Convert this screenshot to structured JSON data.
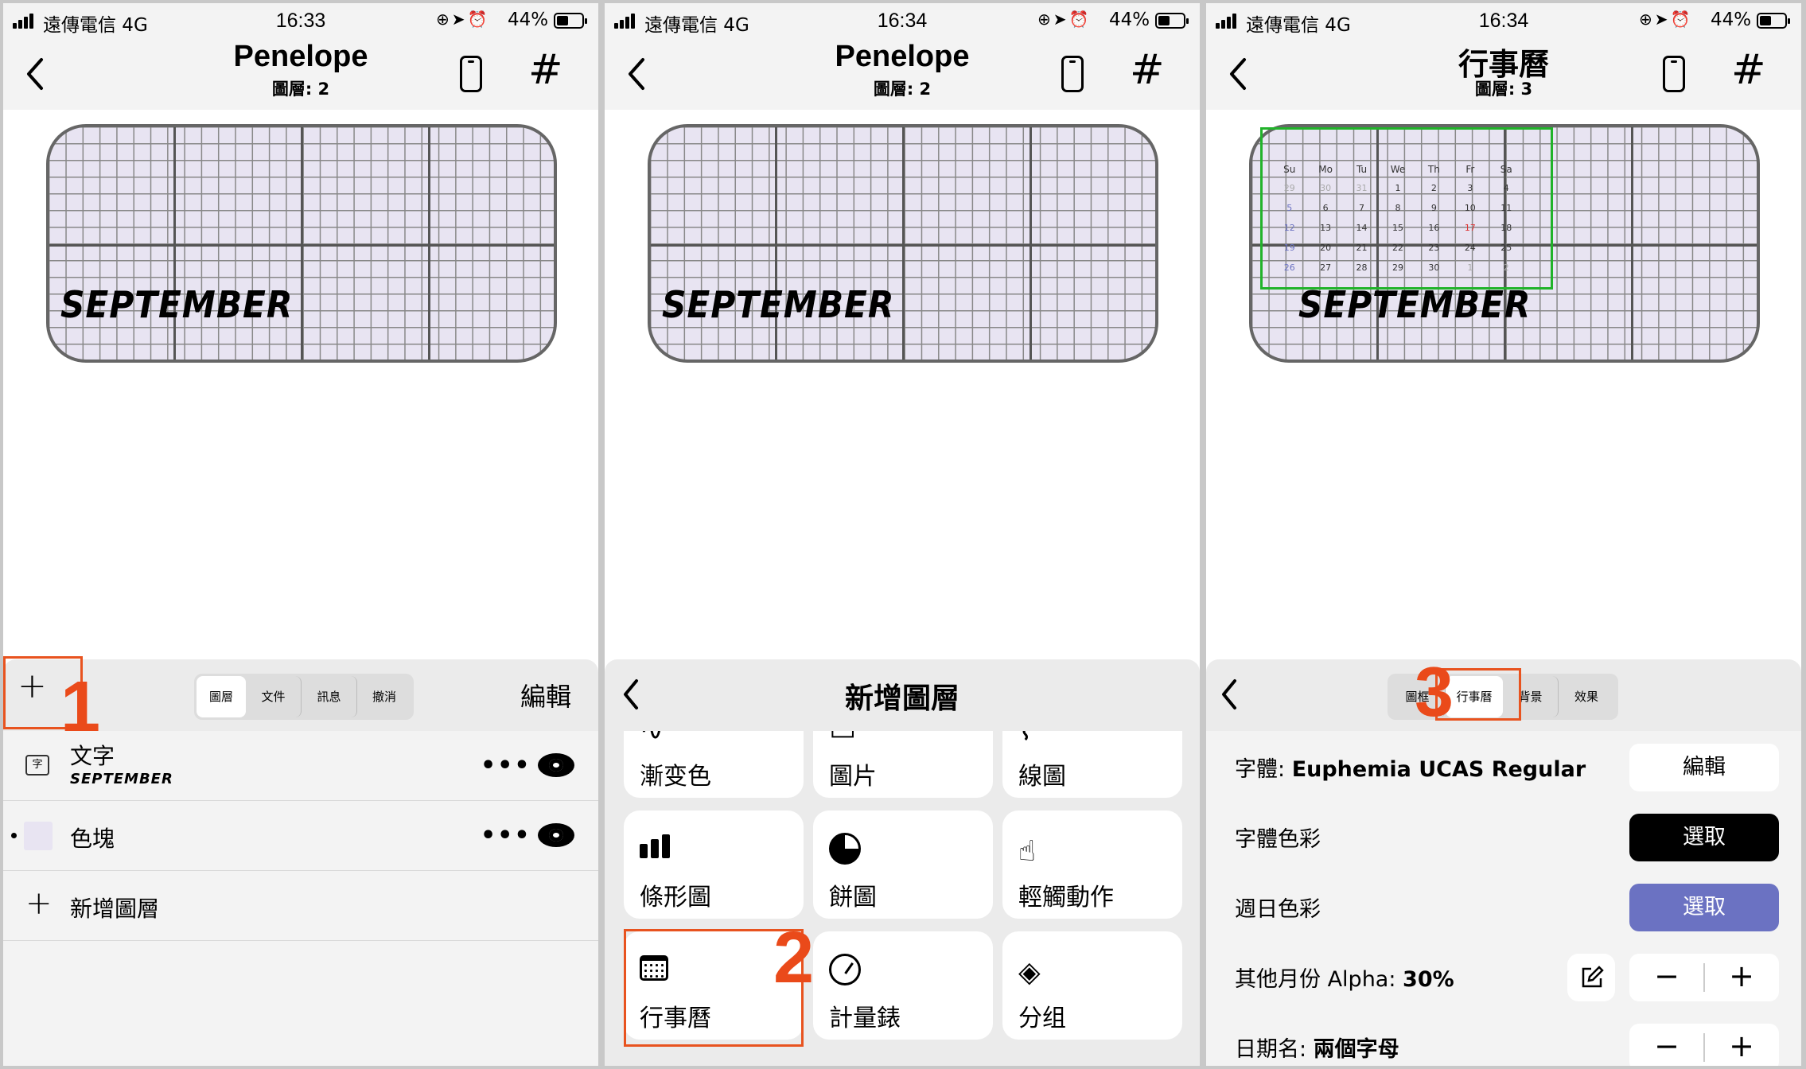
{
  "colors": {
    "accent_red": "#e8531f",
    "green_highlight": "#21b32a",
    "purple_button": "#6b72c2",
    "card_fill": "#e8e4f2"
  },
  "panels": [
    {
      "status": {
        "carrier": "遠傳電信  4G",
        "time": "16:33",
        "battery": "44%"
      },
      "nav": {
        "title": "Penelope",
        "subtitle": "圖層: 2"
      },
      "card_text": "SEPTEMBER",
      "toolbar": {
        "add": "+",
        "tabs": [
          "圖層",
          "文件",
          "訊息",
          "撤消"
        ],
        "edit": "編輯",
        "step": "1"
      },
      "layers": [
        {
          "name": "文字",
          "detail": "SEPTEMBER",
          "icon": "字"
        },
        {
          "name": "色塊",
          "detail": ""
        }
      ],
      "add_layer": "新增圖層"
    },
    {
      "status": {
        "carrier": "遠傳電信  4G",
        "time": "16:34",
        "battery": "44%"
      },
      "nav": {
        "title": "Penelope",
        "subtitle": "圖層: 2"
      },
      "card_text": "SEPTEMBER",
      "header": "新增圖層",
      "step": "2",
      "tiles": [
        "漸变色",
        "圖片",
        "線圖",
        "條形圖",
        "餅圖",
        "輕觸動作",
        "行事曆",
        "計量錶",
        "分组"
      ]
    },
    {
      "status": {
        "carrier": "遠傳電信  4G",
        "time": "16:34",
        "battery": "44%"
      },
      "nav": {
        "title": "行事曆",
        "subtitle": "圖層: 3"
      },
      "card_text": "SEPTEMBER",
      "tabs": [
        "圖框",
        "行事曆",
        "背景",
        "效果"
      ],
      "step": "3",
      "calendar": {
        "days": [
          "Su",
          "Mo",
          "Tu",
          "We",
          "Th",
          "Fr",
          "Sa"
        ],
        "weeks": [
          [
            "29",
            "30",
            "31",
            "1",
            "2",
            "3",
            "4"
          ],
          [
            "5",
            "6",
            "7",
            "8",
            "9",
            "10",
            "11"
          ],
          [
            "12",
            "13",
            "14",
            "15",
            "16",
            "17",
            "18"
          ],
          [
            "19",
            "20",
            "21",
            "22",
            "23",
            "24",
            "25"
          ],
          [
            "26",
            "27",
            "28",
            "29",
            "30",
            "1",
            "2"
          ]
        ]
      },
      "props": {
        "font_label": "字體: ",
        "font_value": "Euphemia UCAS Regular",
        "font_btn": "編輯",
        "font_color_label": "字體色彩",
        "font_color_btn": "選取",
        "sunday_color_label": "週日色彩",
        "sunday_color_btn": "選取",
        "other_alpha_label": "其他月份 Alpha: ",
        "other_alpha_value": "30%",
        "dayname_label": "日期名: ",
        "dayname_value": "兩個字母"
      }
    }
  ]
}
